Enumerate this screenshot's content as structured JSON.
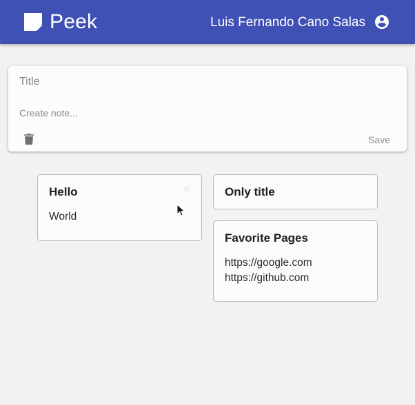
{
  "app": {
    "title": "Peek",
    "user_name": "Luis Fernando Cano Salas",
    "brand_icon": "note-icon",
    "user_icon": "account-circle-icon",
    "accent_color": "#3f51b5"
  },
  "editor": {
    "title_placeholder": "Title",
    "title_value": "",
    "note_placeholder": "Create note...",
    "note_value": "",
    "delete_icon": "trash-icon",
    "save_label": "Save"
  },
  "notes": [
    {
      "title": "Hello",
      "body": "World",
      "close_icon": "close-icon"
    },
    {
      "title": "Only title",
      "body": ""
    },
    {
      "title": "Favorite Pages",
      "body": "https://google.com\nhttps://github.com"
    }
  ]
}
